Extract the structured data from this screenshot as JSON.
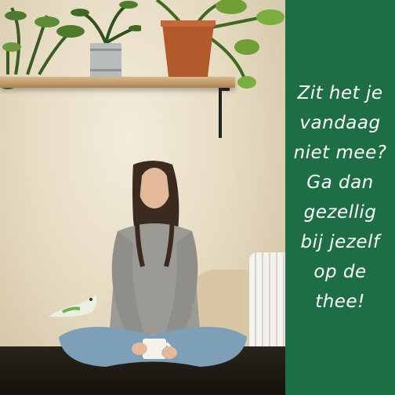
{
  "quote": {
    "lines": [
      "Zit het je",
      "vandaag",
      "niet mee?",
      "Ga dan",
      "gezellig",
      "bij jezelf",
      "op de",
      "thee!"
    ]
  },
  "colors": {
    "panel": "#1d6e45",
    "text": "#ffffff",
    "wall": "#efe6d2",
    "shelf": "#c9a26e"
  }
}
